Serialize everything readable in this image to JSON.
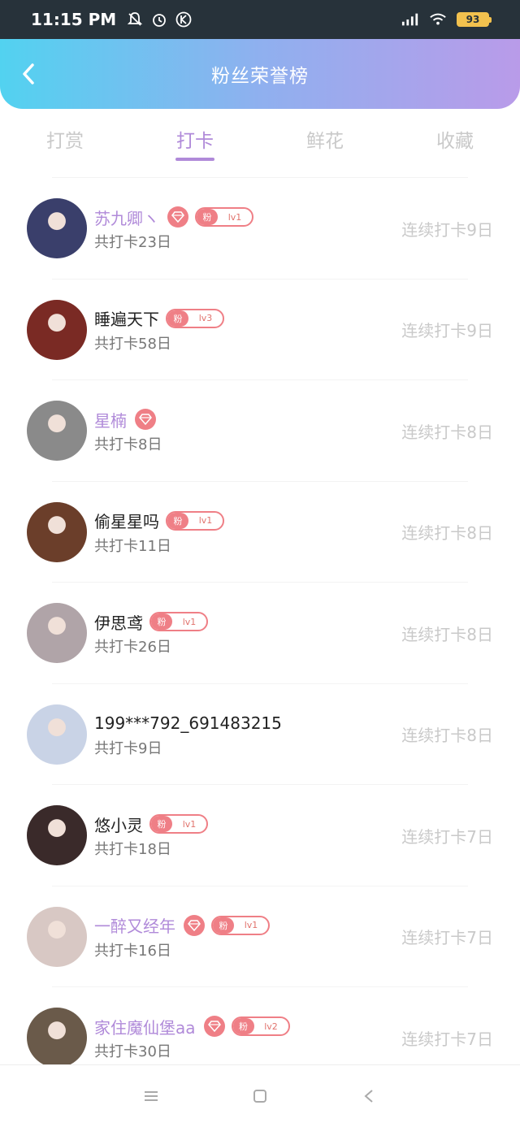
{
  "status_bar": {
    "time": "11:15 PM",
    "battery": "93",
    "icons": [
      "bell-off-icon",
      "alarm-icon",
      "k-icon",
      "signal-icon",
      "wifi-icon",
      "battery-icon"
    ]
  },
  "header": {
    "title": "粉丝荣誉榜",
    "back_icon": "chevron-left-icon"
  },
  "tabs": [
    {
      "label": "打赏",
      "active": false
    },
    {
      "label": "打卡",
      "active": true
    },
    {
      "label": "鲜花",
      "active": false
    },
    {
      "label": "收藏",
      "active": false
    }
  ],
  "badge": {
    "fan_text": "粉"
  },
  "rows": [
    {
      "name": "苏九卿ヽ",
      "vip": true,
      "level": "lv1",
      "total": "共打卡23日",
      "streak": "连续打卡9日",
      "avatar_color": "#3a3f6b"
    },
    {
      "name": "睡遍天下",
      "vip": false,
      "level": "lv3",
      "total": "共打卡58日",
      "streak": "连续打卡9日",
      "avatar_color": "#7a2a24"
    },
    {
      "name": "星楠",
      "vip": true,
      "level": "",
      "total": "共打卡8日",
      "streak": "连续打卡8日",
      "avatar_color": "#8a8a8a"
    },
    {
      "name": "偷星星吗",
      "vip": false,
      "level": "lv1",
      "total": "共打卡11日",
      "streak": "连续打卡8日",
      "avatar_color": "#6b3e2a"
    },
    {
      "name": "伊思鸢",
      "vip": false,
      "level": "lv1",
      "total": "共打卡26日",
      "streak": "连续打卡8日",
      "avatar_color": "#b0a4a8"
    },
    {
      "name": "199***792_691483215",
      "vip": false,
      "level": "",
      "total": "共打卡9日",
      "streak": "连续打卡8日",
      "avatar_color": "#c9d3e6"
    },
    {
      "name": "悠小灵",
      "vip": false,
      "level": "lv1",
      "total": "共打卡18日",
      "streak": "连续打卡7日",
      "avatar_color": "#3a2a2a"
    },
    {
      "name": "一醉又经年",
      "vip": true,
      "level": "lv1",
      "total": "共打卡16日",
      "streak": "连续打卡7日",
      "avatar_color": "#d8c8c4"
    },
    {
      "name": "家住魔仙堡aa",
      "vip": true,
      "level": "lv2",
      "total": "共打卡30日",
      "streak": "连续打卡7日",
      "avatar_color": "#6a5a4a"
    }
  ],
  "nav": [
    "menu-icon",
    "home-square-icon",
    "back-triangle-icon"
  ]
}
